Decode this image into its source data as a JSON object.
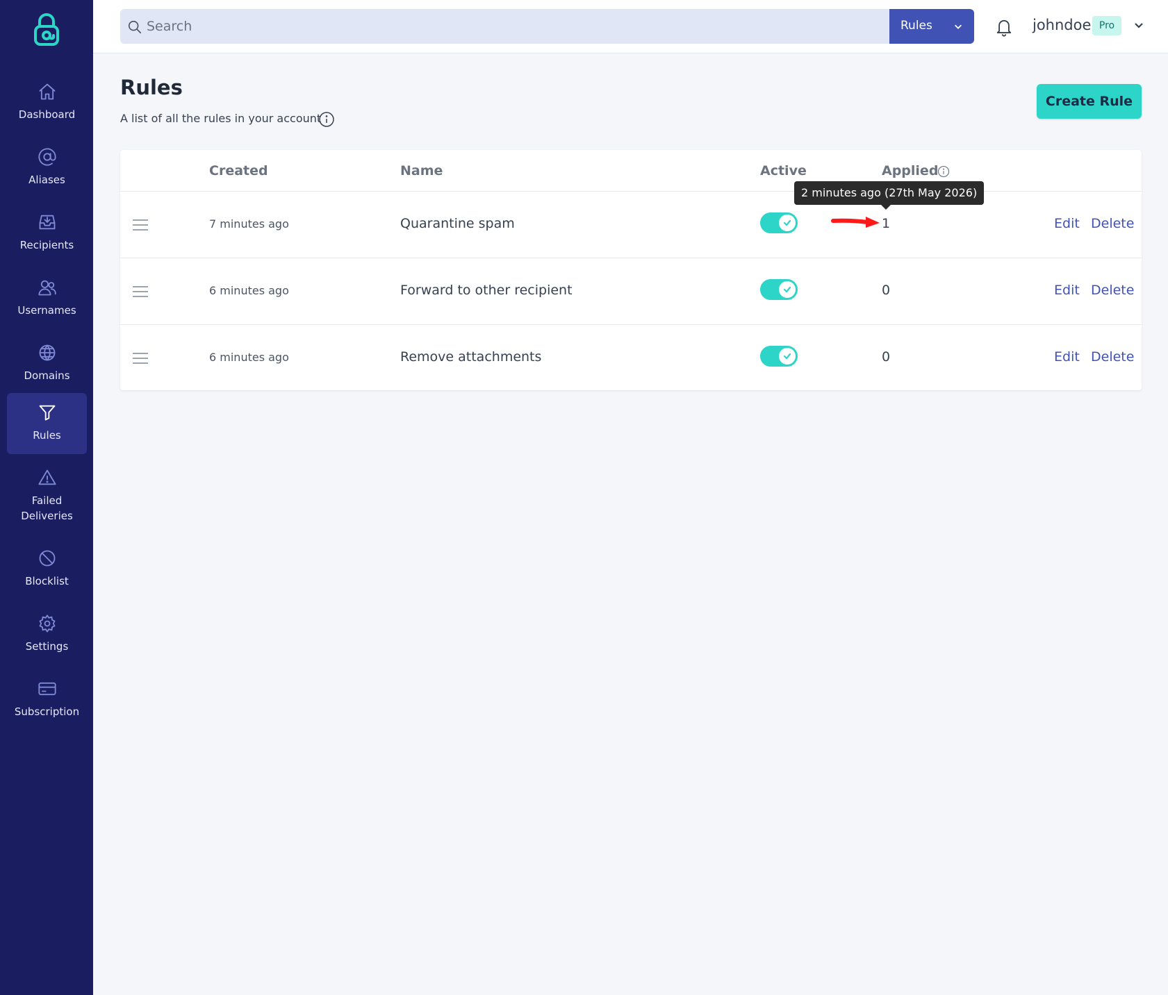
{
  "sidebar": {
    "logo": "anonaddy-logo-icon",
    "items": [
      {
        "label": "Dashboard",
        "icon": "home-icon",
        "active": false
      },
      {
        "label": "Aliases",
        "icon": "at-sign-icon",
        "active": false
      },
      {
        "label": "Recipients",
        "icon": "inbox-icon",
        "active": false
      },
      {
        "label": "Usernames",
        "icon": "users-icon",
        "active": false
      },
      {
        "label": "Domains",
        "icon": "globe-icon",
        "active": false
      },
      {
        "label": "Rules",
        "icon": "filter-icon",
        "active": true
      },
      {
        "label": "Failed\nDeliveries",
        "icon": "alert-triangle-icon",
        "active": false
      },
      {
        "label": "Blocklist",
        "icon": "block-icon",
        "active": false
      },
      {
        "label": "Settings",
        "icon": "gear-icon",
        "active": false
      },
      {
        "label": "Subscription",
        "icon": "credit-card-icon",
        "active": false
      }
    ]
  },
  "topbar": {
    "search_placeholder": "Search",
    "search_value": "",
    "scope_label": "Rules",
    "username": "johndoe",
    "plan_badge": "Pro"
  },
  "page": {
    "title": "Rules",
    "subtitle": "A list of all the rules in your account",
    "create_button": "Create Rule"
  },
  "table": {
    "columns": [
      "Created",
      "Name",
      "Active",
      "Applied"
    ],
    "rows": [
      {
        "created": "7 minutes ago",
        "name": "Quarantine spam",
        "active": true,
        "applied": "1",
        "edit": "Edit",
        "delete": "Delete"
      },
      {
        "created": "6 minutes ago",
        "name": "Forward to other recipient",
        "active": true,
        "applied": "0",
        "edit": "Edit",
        "delete": "Delete"
      },
      {
        "created": "6 minutes ago",
        "name": "Remove attachments",
        "active": true,
        "applied": "0",
        "edit": "Edit",
        "delete": "Delete"
      }
    ]
  },
  "tooltip": {
    "text": "2 minutes ago (27th May 2026)"
  },
  "colors": {
    "sidebar_bg": "#1a1d5f",
    "accent_teal": "#2dd4c8",
    "brand_blue": "#4152b5",
    "annotation_red": "#ff0000"
  }
}
